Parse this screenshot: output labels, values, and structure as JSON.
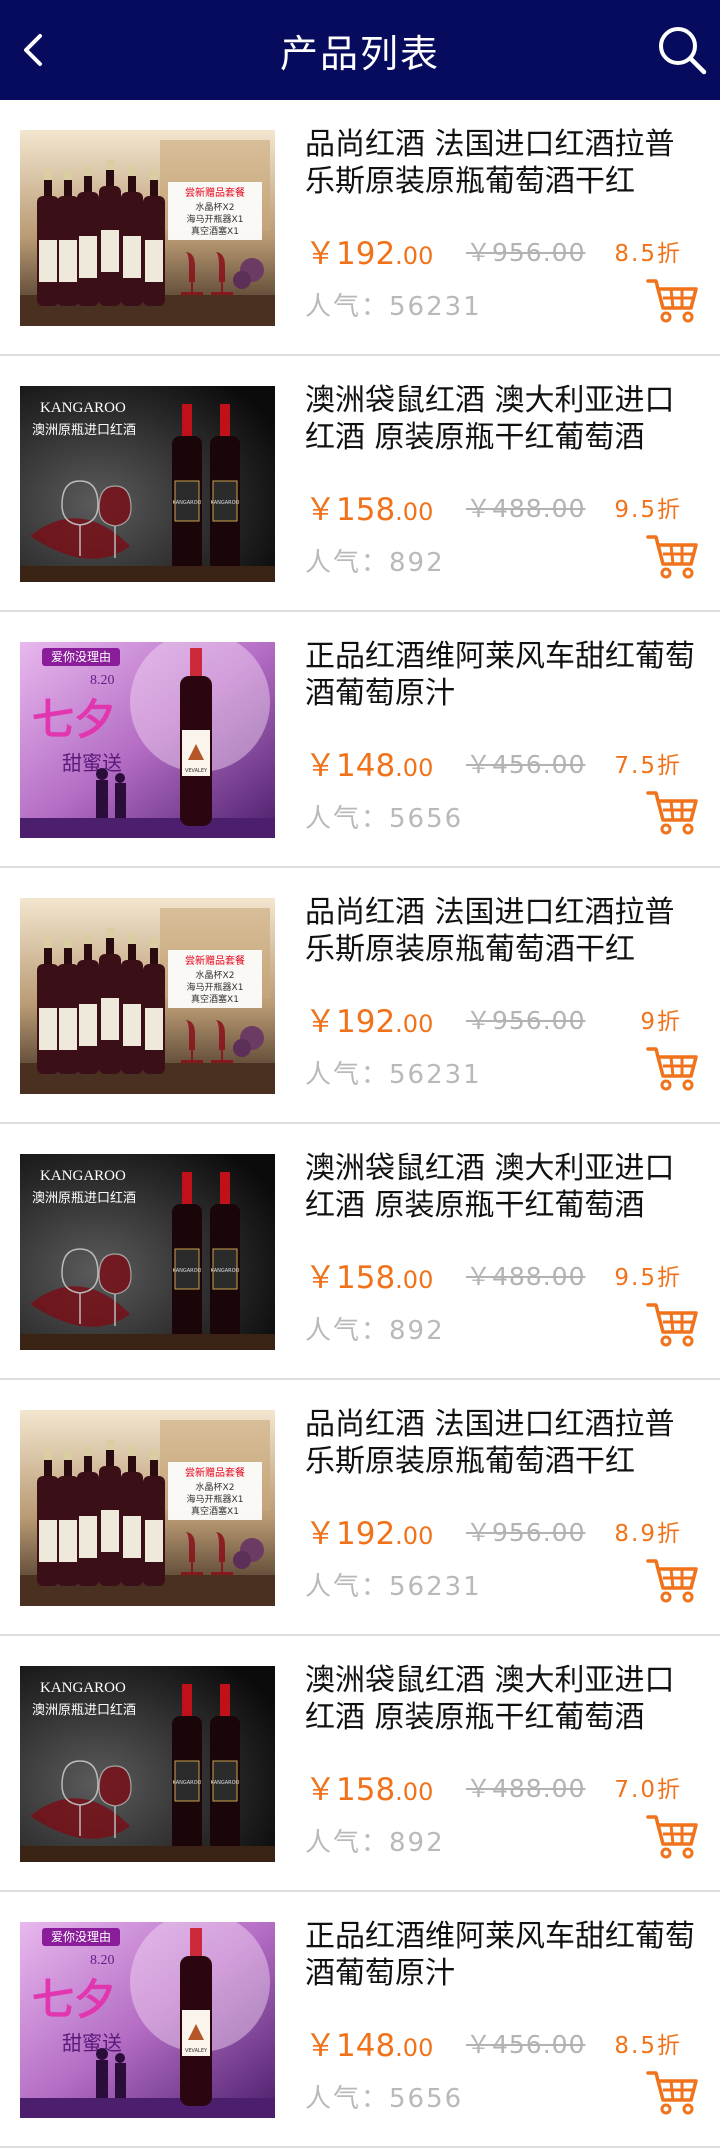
{
  "header": {
    "title": "产品列表",
    "back_icon": "back-arrow-icon",
    "search_icon": "search-icon",
    "background": "#070b5e"
  },
  "colors": {
    "accent": "#f0731c",
    "muted": "#b9b9b9",
    "divider": "#dedede"
  },
  "products": [
    {
      "name": "品尚红酒 法国进口红酒拉普乐斯原装原瓶葡萄酒干红",
      "price_int": "￥192",
      "price_dec": ".00",
      "old_price": "￥956.00",
      "discount": "8.5折",
      "popularity": "人气：56231",
      "image": "lourds"
    },
    {
      "name": "澳洲袋鼠红酒 澳大利亚进口红酒 原装原瓶干红葡萄酒",
      "price_int": "￥158",
      "price_dec": ".00",
      "old_price": "￥488.00",
      "discount": "9.5折",
      "popularity": "人气：892",
      "image": "kangaroo"
    },
    {
      "name": "正品红酒维阿莱风车甜红葡萄酒葡萄原汁",
      "price_int": "￥148",
      "price_dec": ".00",
      "old_price": "￥456.00",
      "discount": "7.5折",
      "popularity": "人气：5656",
      "image": "vevaley"
    },
    {
      "name": "品尚红酒 法国进口红酒拉普乐斯原装原瓶葡萄酒干红",
      "price_int": "￥192",
      "price_dec": ".00",
      "old_price": "￥956.00",
      "discount": "9折",
      "popularity": "人气：56231",
      "image": "lourds"
    },
    {
      "name": "澳洲袋鼠红酒 澳大利亚进口红酒 原装原瓶干红葡萄酒",
      "price_int": "￥158",
      "price_dec": ".00",
      "old_price": "￥488.00",
      "discount": "9.5折",
      "popularity": "人气：892",
      "image": "kangaroo"
    },
    {
      "name": "品尚红酒 法国进口红酒拉普乐斯原装原瓶葡萄酒干红",
      "price_int": "￥192",
      "price_dec": ".00",
      "old_price": "￥956.00",
      "discount": "8.9折",
      "popularity": "人气：56231",
      "image": "lourds"
    },
    {
      "name": "澳洲袋鼠红酒 澳大利亚进口红酒 原装原瓶干红葡萄酒",
      "price_int": "￥158",
      "price_dec": ".00",
      "old_price": "￥488.00",
      "discount": "7.0折",
      "popularity": "人气：892",
      "image": "kangaroo"
    },
    {
      "name": "正品红酒维阿莱风车甜红葡萄酒葡萄原汁",
      "price_int": "￥148",
      "price_dec": ".00",
      "old_price": "￥456.00",
      "discount": "8.5折",
      "popularity": "人气：5656",
      "image": "vevaley"
    }
  ],
  "image_text": {
    "lourds": {
      "badge": "尝新赠品套餐",
      "line1": "水晶杯X2",
      "line2": "海马开瓶器X1",
      "line3": "真空酒塞X1",
      "label": "LOURDS"
    },
    "kangaroo": {
      "brand": "KANGAROO",
      "subtitle": "澳洲原瓶进口红酒",
      "label": "KANGAROO"
    },
    "vevaley": {
      "tag": "爱你没理由",
      "date": "8.20",
      "big": "七夕",
      "sub": "甜蜜送",
      "label": "VEVALEY"
    }
  },
  "cart_icon": "shopping-cart-icon"
}
